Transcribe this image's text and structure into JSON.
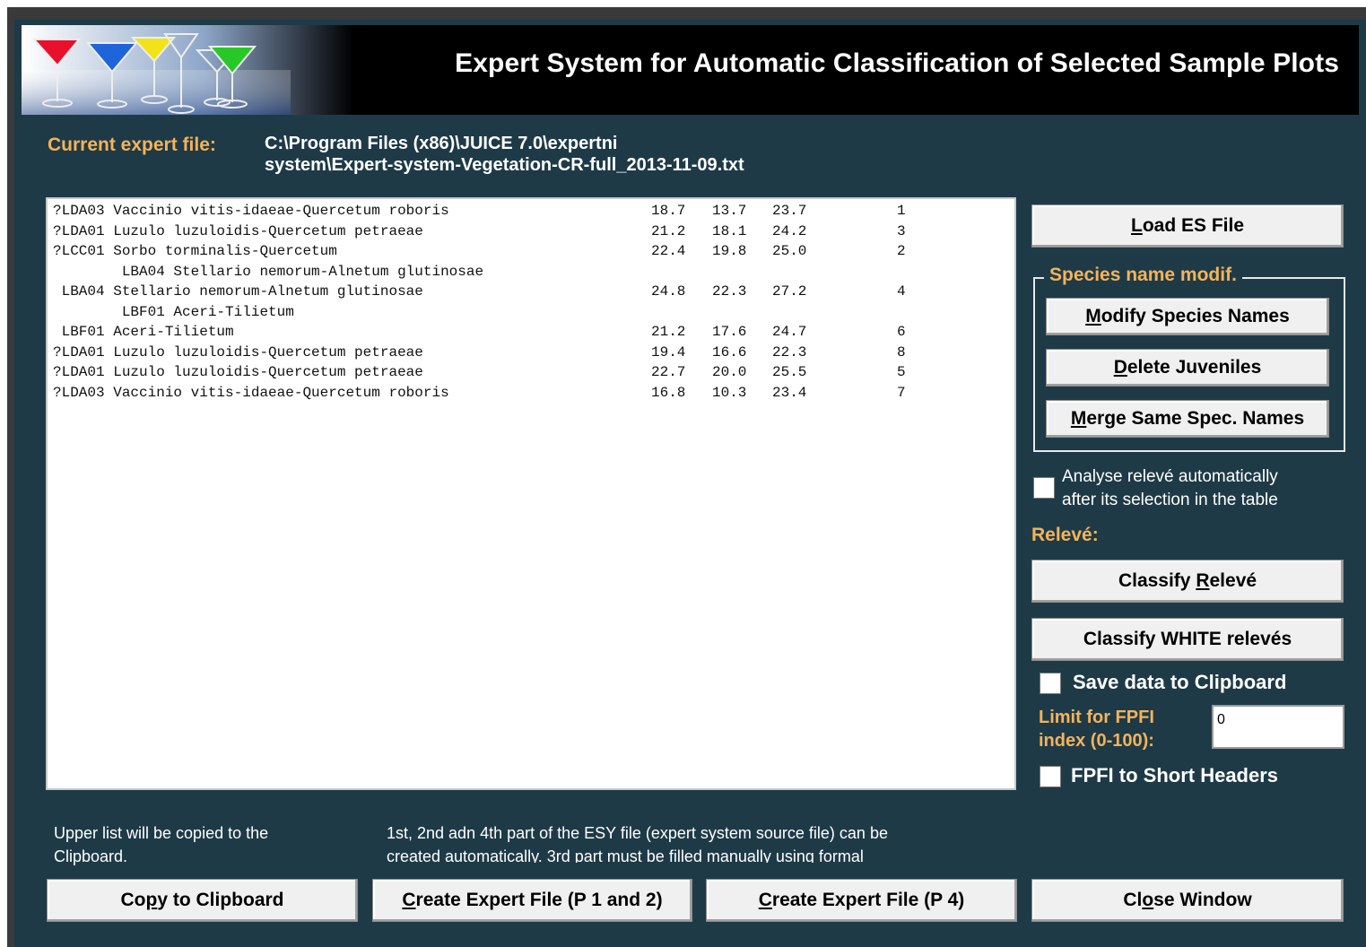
{
  "banner": {
    "title": "Expert System for Automatic Classification of Selected Sample Plots"
  },
  "expert_file": {
    "label": "Current  expert  file:",
    "path_line1": "C:\\Program Files (x86)\\JUICE 7.0\\expertni",
    "path_line2": "system\\Expert-system-Vegetation-CR-full_2013-11-09.txt"
  },
  "results": [
    {
      "name": "?LDA03 Vaccinio vitis-idaeae-Quercetum roboris",
      "v1": "18.7",
      "v2": "13.7",
      "v3": "23.7",
      "n": "1"
    },
    {
      "name": "?LDA01 Luzulo luzuloidis-Quercetum petraeae",
      "v1": "21.2",
      "v2": "18.1",
      "v3": "24.2",
      "n": "3"
    },
    {
      "name": "?LCC01 Sorbo torminalis-Quercetum",
      "v1": "22.4",
      "v2": "19.8",
      "v3": "25.0",
      "n": "2"
    },
    {
      "name": "        LBA04 Stellario nemorum-Alnetum glutinosae",
      "v1": "",
      "v2": "",
      "v3": "",
      "n": ""
    },
    {
      "name": " LBA04 Stellario nemorum-Alnetum glutinosae",
      "v1": "24.8",
      "v2": "22.3",
      "v3": "27.2",
      "n": "4"
    },
    {
      "name": "        LBF01 Aceri-Tilietum",
      "v1": "",
      "v2": "",
      "v3": "",
      "n": ""
    },
    {
      "name": " LBF01 Aceri-Tilietum",
      "v1": "21.2",
      "v2": "17.6",
      "v3": "24.7",
      "n": "6"
    },
    {
      "name": "?LDA01 Luzulo luzuloidis-Quercetum petraeae",
      "v1": "19.4",
      "v2": "16.6",
      "v3": "22.3",
      "n": "8"
    },
    {
      "name": "?LDA01 Luzulo luzuloidis-Quercetum petraeae",
      "v1": "22.7",
      "v2": "20.0",
      "v3": "25.5",
      "n": "5"
    },
    {
      "name": "?LDA03 Vaccinio vitis-idaeae-Quercetum roboris",
      "v1": "16.8",
      "v2": "10.3",
      "v3": "23.4",
      "n": "7"
    }
  ],
  "buttons": {
    "load": {
      "ul": "L",
      "rest": "oad ES File"
    },
    "modify": {
      "ul": "M",
      "rest": "odify Species Names"
    },
    "delete": {
      "ul": "D",
      "rest": "elete Juveniles"
    },
    "merge": {
      "ul": "M",
      "rest": "erge Same Spec. Names"
    },
    "classify_releve": {
      "pre": "Classify ",
      "ul": "R",
      "rest": "elevé"
    },
    "classify_white": "Classify WHITE relevés",
    "copy": {
      "pre": "Co",
      "ul": "p",
      "rest": "y to Clipboard"
    },
    "create_p12": {
      "ul": "C",
      "rest": "reate Expert File (P 1 and 2)"
    },
    "create_p4": {
      "ul": "C",
      "rest": "reate Expert File (P 4)"
    },
    "close": {
      "pre": "Cl",
      "ul": "o",
      "rest": "se Window"
    }
  },
  "species_group": {
    "legend": "Species name modif."
  },
  "auto_analyse": {
    "line1": "Analyse relevé automatically",
    "line2": "after its selection in the table",
    "checked": false
  },
  "releve_label": "Relevé:",
  "save_clipboard": {
    "label": "Save data to Clipboard",
    "checked": false
  },
  "fpfi_limit": {
    "line1": "Limit for FPFI",
    "line2": "index (0-100):",
    "value": "0"
  },
  "fpfi_short": {
    "label": "FPFI to Short Headers",
    "checked": false
  },
  "hints": {
    "copy_line1": "Upper list will be copied to the",
    "copy_line2": "Clipboard.",
    "esy_line1": "1st, 2nd adn 4th part of the ESY file (expert system source file) can be",
    "esy_line2": "created automatically. 3rd part must be filled manually using formal"
  }
}
